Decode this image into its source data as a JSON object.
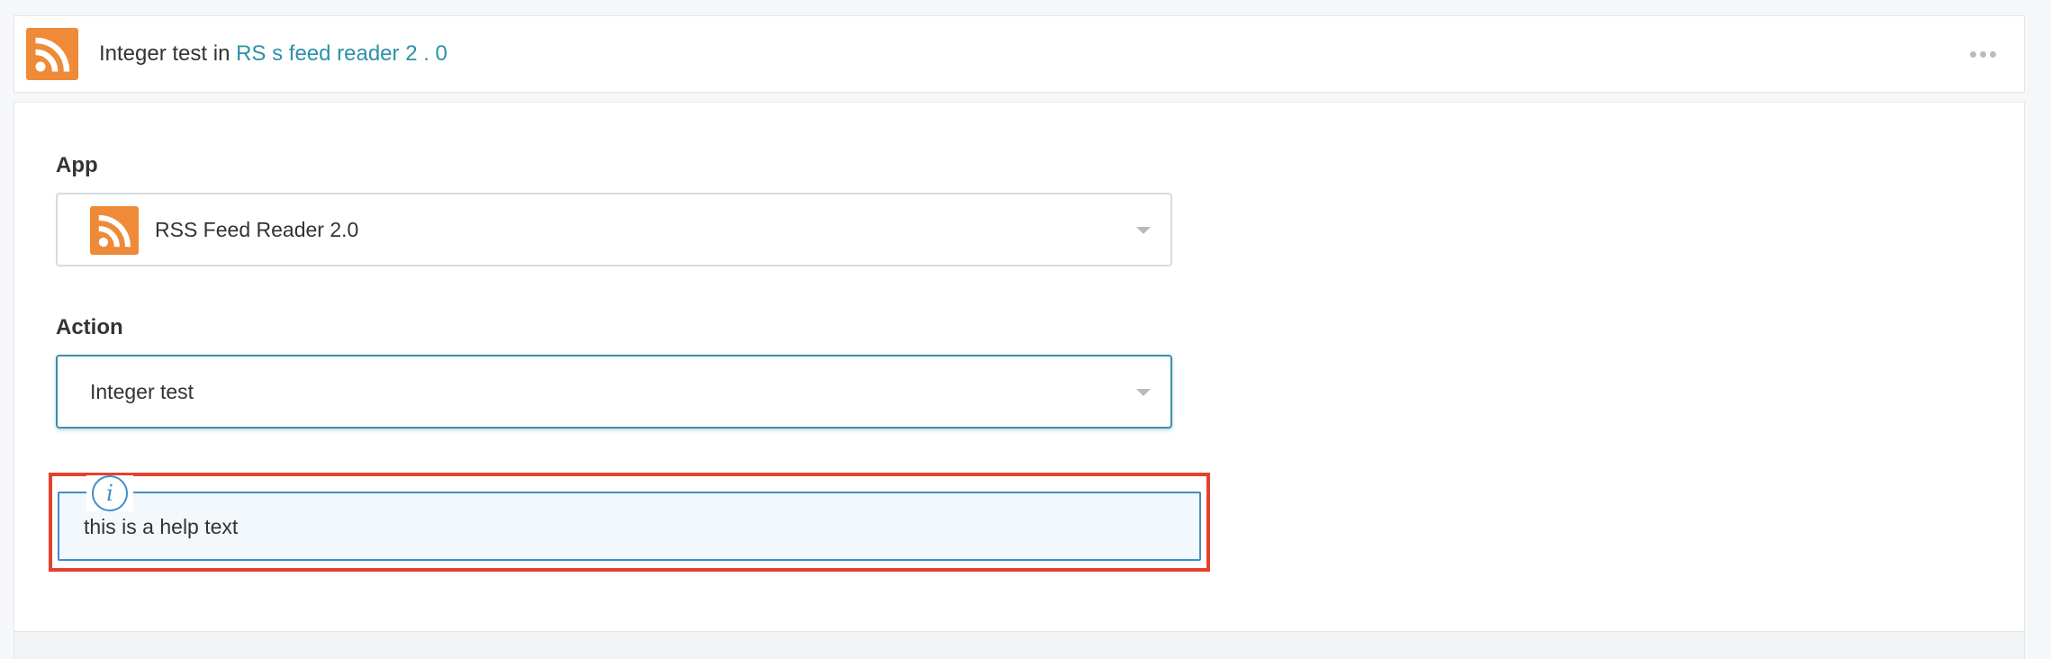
{
  "header": {
    "title_prefix": "Integer test in ",
    "app_link": "RS s feed reader 2 . 0",
    "logo_icon": "rss-icon",
    "menu_icon": "more-horizontal-icon"
  },
  "form": {
    "app": {
      "label": "App",
      "value": "RSS Feed Reader 2.0",
      "icon": "rss-icon"
    },
    "action": {
      "label": "Action",
      "value": "Integer test"
    },
    "help": {
      "icon": "info-icon",
      "glyph": "i",
      "text": "this is a help text"
    }
  },
  "colors": {
    "rss_orange": "#ee8a38",
    "link_teal": "#2d91a8",
    "focus_border": "#3e8ea7",
    "help_border": "#3e8ec7",
    "highlight_red": "#e5412c"
  }
}
